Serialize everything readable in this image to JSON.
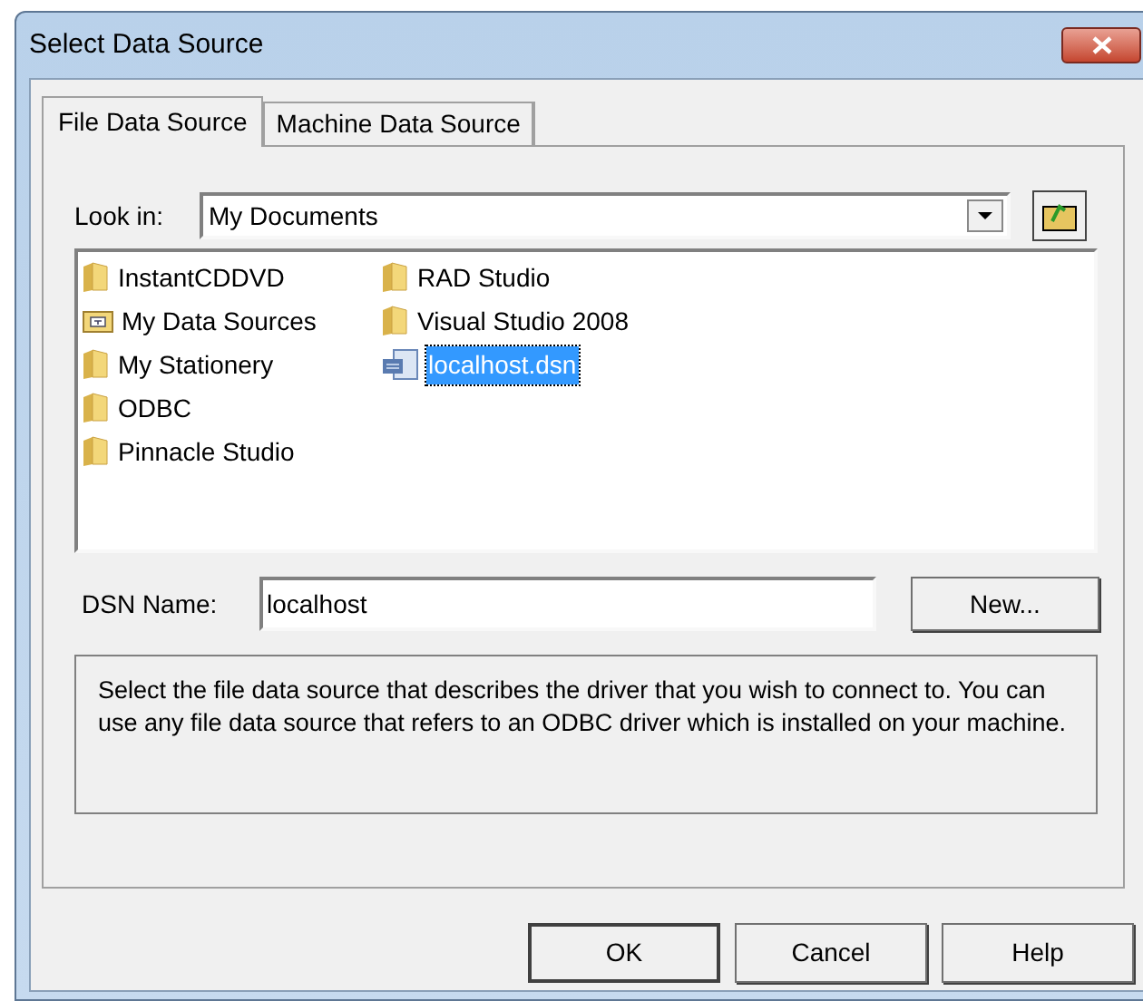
{
  "window": {
    "title": "Select Data Source"
  },
  "tabs": [
    {
      "label": "File Data Source",
      "selected": true
    },
    {
      "label": "Machine Data Source",
      "selected": false
    }
  ],
  "look_in": {
    "label": "Look in:",
    "value": "My Documents"
  },
  "files": [
    {
      "name": "InstantCDDVD",
      "kind": "folder",
      "selected": false
    },
    {
      "name": "My Data Sources",
      "kind": "datafolder",
      "selected": false
    },
    {
      "name": "My Stationery",
      "kind": "folder",
      "selected": false
    },
    {
      "name": "ODBC",
      "kind": "folder",
      "selected": false
    },
    {
      "name": "Pinnacle Studio",
      "kind": "folder",
      "selected": false
    },
    {
      "name": "RAD Studio",
      "kind": "folder",
      "selected": false
    },
    {
      "name": "Visual Studio 2008",
      "kind": "folder",
      "selected": false
    },
    {
      "name": "localhost.dsn",
      "kind": "dsn",
      "selected": true
    }
  ],
  "dsn_name": {
    "label": "DSN Name:",
    "value": "localhost",
    "button": "New..."
  },
  "description": "Select the file data source that describes the driver that you wish to connect to. You can use any file data source that refers to an ODBC driver which is installed on your machine.",
  "buttons": [
    "OK",
    "Cancel",
    "Help"
  ]
}
